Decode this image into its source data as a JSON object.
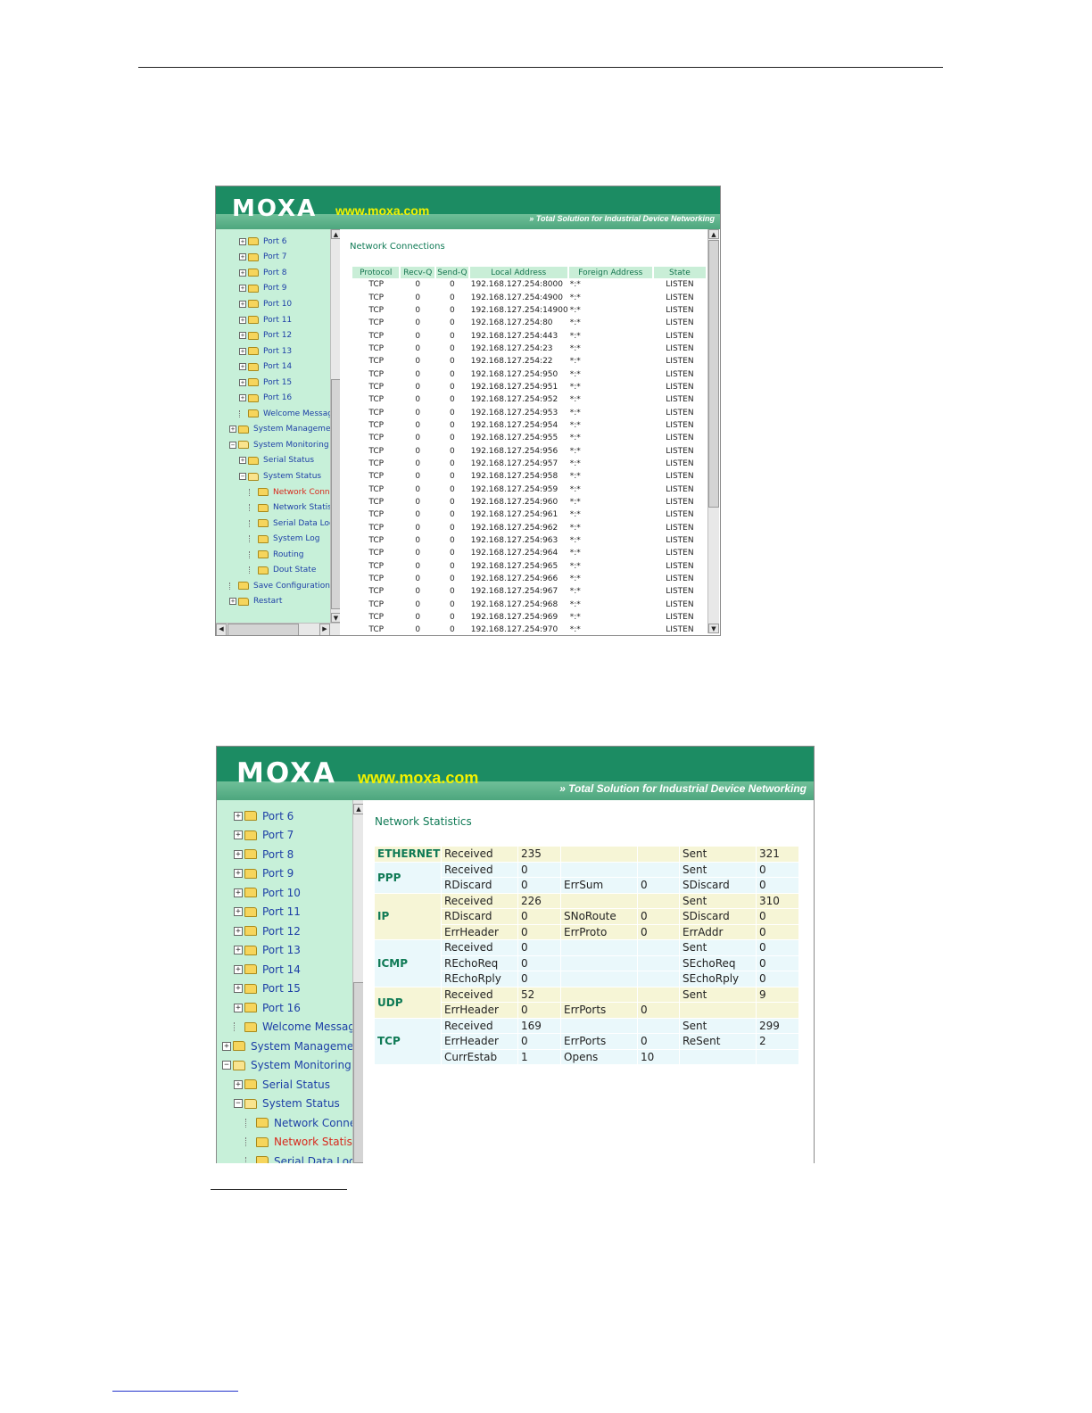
{
  "branding": {
    "logo": "MOXA",
    "url": "www.moxa.com",
    "tagline": "Total Solution for Industrial Device Networking"
  },
  "colors": {
    "banner_green": "#1c8c63",
    "sidebar_bg": "#c7f0d9",
    "link_blue": "#1d3fa6",
    "active_red": "#d8281c",
    "title_green": "#0f7a55",
    "logo_yellow": "#f2f200"
  },
  "screen1": {
    "sidebar": {
      "items": [
        {
          "label": "Port 6",
          "icon": "folder-icon",
          "expander": "plus"
        },
        {
          "label": "Port 7",
          "icon": "folder-icon",
          "expander": "plus"
        },
        {
          "label": "Port 8",
          "icon": "folder-icon",
          "expander": "plus"
        },
        {
          "label": "Port 9",
          "icon": "folder-icon",
          "expander": "plus"
        },
        {
          "label": "Port 10",
          "icon": "folder-icon",
          "expander": "plus"
        },
        {
          "label": "Port 11",
          "icon": "folder-icon",
          "expander": "plus"
        },
        {
          "label": "Port 12",
          "icon": "folder-icon",
          "expander": "plus"
        },
        {
          "label": "Port 13",
          "icon": "folder-icon",
          "expander": "plus"
        },
        {
          "label": "Port 14",
          "icon": "folder-icon",
          "expander": "plus"
        },
        {
          "label": "Port 15",
          "icon": "folder-icon",
          "expander": "plus"
        },
        {
          "label": "Port 16",
          "icon": "folder-icon",
          "expander": "plus"
        },
        {
          "label": "Welcome Message",
          "icon": "folder-icon",
          "expander": "none"
        },
        {
          "label": "System Management",
          "icon": "folder-icon",
          "expander": "plus"
        },
        {
          "label": "System Monitoring",
          "icon": "open-folder-icon",
          "expander": "minus"
        },
        {
          "label": "Serial Status",
          "icon": "folder-icon",
          "expander": "plus"
        },
        {
          "label": "System Status",
          "icon": "open-folder-icon",
          "expander": "minus"
        },
        {
          "label": "Network Connecti",
          "icon": "folder-icon",
          "expander": "none",
          "active": true
        },
        {
          "label": "Network Statistics",
          "icon": "folder-icon",
          "expander": "none"
        },
        {
          "label": "Serial Data Log",
          "icon": "folder-icon",
          "expander": "none"
        },
        {
          "label": "System Log",
          "icon": "folder-icon",
          "expander": "none"
        },
        {
          "label": "Routing",
          "icon": "folder-icon",
          "expander": "none"
        },
        {
          "label": "Dout State",
          "icon": "folder-icon",
          "expander": "none"
        },
        {
          "label": "Save Configuration",
          "icon": "folder-icon",
          "expander": "none"
        },
        {
          "label": "Restart",
          "icon": "folder-icon",
          "expander": "plus"
        }
      ]
    },
    "title": "Network Connections",
    "table": {
      "headers": [
        "Protocol",
        "Recv-Q",
        "Send-Q",
        "Local Address",
        "Foreign Address",
        "State"
      ],
      "rows": [
        [
          "TCP",
          "0",
          "0",
          "192.168.127.254:8000",
          "*:*",
          "LISTEN"
        ],
        [
          "TCP",
          "0",
          "0",
          "192.168.127.254:4900",
          "*:*",
          "LISTEN"
        ],
        [
          "TCP",
          "0",
          "0",
          "192.168.127.254:14900",
          "*:*",
          "LISTEN"
        ],
        [
          "TCP",
          "0",
          "0",
          "192.168.127.254:80",
          "*:*",
          "LISTEN"
        ],
        [
          "TCP",
          "0",
          "0",
          "192.168.127.254:443",
          "*:*",
          "LISTEN"
        ],
        [
          "TCP",
          "0",
          "0",
          "192.168.127.254:23",
          "*:*",
          "LISTEN"
        ],
        [
          "TCP",
          "0",
          "0",
          "192.168.127.254:22",
          "*:*",
          "LISTEN"
        ],
        [
          "TCP",
          "0",
          "0",
          "192.168.127.254:950",
          "*:*",
          "LISTEN"
        ],
        [
          "TCP",
          "0",
          "0",
          "192.168.127.254:951",
          "*:*",
          "LISTEN"
        ],
        [
          "TCP",
          "0",
          "0",
          "192.168.127.254:952",
          "*:*",
          "LISTEN"
        ],
        [
          "TCP",
          "0",
          "0",
          "192.168.127.254:953",
          "*:*",
          "LISTEN"
        ],
        [
          "TCP",
          "0",
          "0",
          "192.168.127.254:954",
          "*:*",
          "LISTEN"
        ],
        [
          "TCP",
          "0",
          "0",
          "192.168.127.254:955",
          "*:*",
          "LISTEN"
        ],
        [
          "TCP",
          "0",
          "0",
          "192.168.127.254:956",
          "*:*",
          "LISTEN"
        ],
        [
          "TCP",
          "0",
          "0",
          "192.168.127.254:957",
          "*:*",
          "LISTEN"
        ],
        [
          "TCP",
          "0",
          "0",
          "192.168.127.254:958",
          "*:*",
          "LISTEN"
        ],
        [
          "TCP",
          "0",
          "0",
          "192.168.127.254:959",
          "*:*",
          "LISTEN"
        ],
        [
          "TCP",
          "0",
          "0",
          "192.168.127.254:960",
          "*:*",
          "LISTEN"
        ],
        [
          "TCP",
          "0",
          "0",
          "192.168.127.254:961",
          "*:*",
          "LISTEN"
        ],
        [
          "TCP",
          "0",
          "0",
          "192.168.127.254:962",
          "*:*",
          "LISTEN"
        ],
        [
          "TCP",
          "0",
          "0",
          "192.168.127.254:963",
          "*:*",
          "LISTEN"
        ],
        [
          "TCP",
          "0",
          "0",
          "192.168.127.254:964",
          "*:*",
          "LISTEN"
        ],
        [
          "TCP",
          "0",
          "0",
          "192.168.127.254:965",
          "*:*",
          "LISTEN"
        ],
        [
          "TCP",
          "0",
          "0",
          "192.168.127.254:966",
          "*:*",
          "LISTEN"
        ],
        [
          "TCP",
          "0",
          "0",
          "192.168.127.254:967",
          "*:*",
          "LISTEN"
        ],
        [
          "TCP",
          "0",
          "0",
          "192.168.127.254:968",
          "*:*",
          "LISTEN"
        ],
        [
          "TCP",
          "0",
          "0",
          "192.168.127.254:969",
          "*:*",
          "LISTEN"
        ],
        [
          "TCP",
          "0",
          "0",
          "192.168.127.254:970",
          "*:*",
          "LISTEN"
        ]
      ]
    }
  },
  "screen2": {
    "sidebar": {
      "items": [
        {
          "label": "Port 6",
          "icon": "folder-icon",
          "expander": "plus"
        },
        {
          "label": "Port 7",
          "icon": "folder-icon",
          "expander": "plus"
        },
        {
          "label": "Port 8",
          "icon": "folder-icon",
          "expander": "plus"
        },
        {
          "label": "Port 9",
          "icon": "folder-icon",
          "expander": "plus"
        },
        {
          "label": "Port 10",
          "icon": "folder-icon",
          "expander": "plus"
        },
        {
          "label": "Port 11",
          "icon": "folder-icon",
          "expander": "plus"
        },
        {
          "label": "Port 12",
          "icon": "folder-icon",
          "expander": "plus"
        },
        {
          "label": "Port 13",
          "icon": "folder-icon",
          "expander": "plus"
        },
        {
          "label": "Port 14",
          "icon": "folder-icon",
          "expander": "plus"
        },
        {
          "label": "Port 15",
          "icon": "folder-icon",
          "expander": "plus"
        },
        {
          "label": "Port 16",
          "icon": "folder-icon",
          "expander": "plus"
        },
        {
          "label": "Welcome Message",
          "icon": "folder-icon",
          "expander": "none"
        },
        {
          "label": "System Management",
          "icon": "folder-icon",
          "expander": "plus"
        },
        {
          "label": "System Monitoring",
          "icon": "open-folder-icon",
          "expander": "minus"
        },
        {
          "label": "Serial Status",
          "icon": "folder-icon",
          "expander": "plus"
        },
        {
          "label": "System Status",
          "icon": "open-folder-icon",
          "expander": "minus"
        },
        {
          "label": "Network Connecti",
          "icon": "folder-icon",
          "expander": "none"
        },
        {
          "label": "Network Statistics",
          "icon": "folder-icon",
          "expander": "none",
          "active": true
        },
        {
          "label": "Serial Data Log",
          "icon": "folder-icon",
          "expander": "none"
        }
      ]
    },
    "title": "Network Statistics",
    "table": {
      "groups": [
        {
          "protocol": "ETHERNET",
          "shade": "y",
          "rows": [
            [
              "Received",
              "235",
              "",
              "",
              "Sent",
              "321"
            ]
          ]
        },
        {
          "protocol": "PPP",
          "shade": "b",
          "rows": [
            [
              "Received",
              "0",
              "",
              "",
              "Sent",
              "0"
            ],
            [
              "RDiscard",
              "0",
              "ErrSum",
              "0",
              "SDiscard",
              "0"
            ]
          ]
        },
        {
          "protocol": "IP",
          "shade": "y",
          "rows": [
            [
              "Received",
              "226",
              "",
              "",
              "Sent",
              "310"
            ],
            [
              "RDiscard",
              "0",
              "SNoRoute",
              "0",
              "SDiscard",
              "0"
            ],
            [
              "ErrHeader",
              "0",
              "ErrProto",
              "0",
              "ErrAddr",
              "0"
            ]
          ]
        },
        {
          "protocol": "ICMP",
          "shade": "b",
          "rows": [
            [
              "Received",
              "0",
              "",
              "",
              "Sent",
              "0"
            ],
            [
              "REchoReq",
              "0",
              "",
              "",
              "SEchoReq",
              "0"
            ],
            [
              "REchoRply",
              "0",
              "",
              "",
              "SEchoRply",
              "0"
            ]
          ]
        },
        {
          "protocol": "UDP",
          "shade": "y",
          "rows": [
            [
              "Received",
              "52",
              "",
              "",
              "Sent",
              "9"
            ],
            [
              "ErrHeader",
              "0",
              "ErrPorts",
              "0",
              "",
              ""
            ]
          ]
        },
        {
          "protocol": "TCP",
          "shade": "b",
          "rows": [
            [
              "Received",
              "169",
              "",
              "",
              "Sent",
              "299"
            ],
            [
              "ErrHeader",
              "0",
              "ErrPorts",
              "0",
              "ReSent",
              "2"
            ],
            [
              "CurrEstab",
              "1",
              "Opens",
              "10",
              "",
              ""
            ]
          ]
        }
      ]
    }
  }
}
